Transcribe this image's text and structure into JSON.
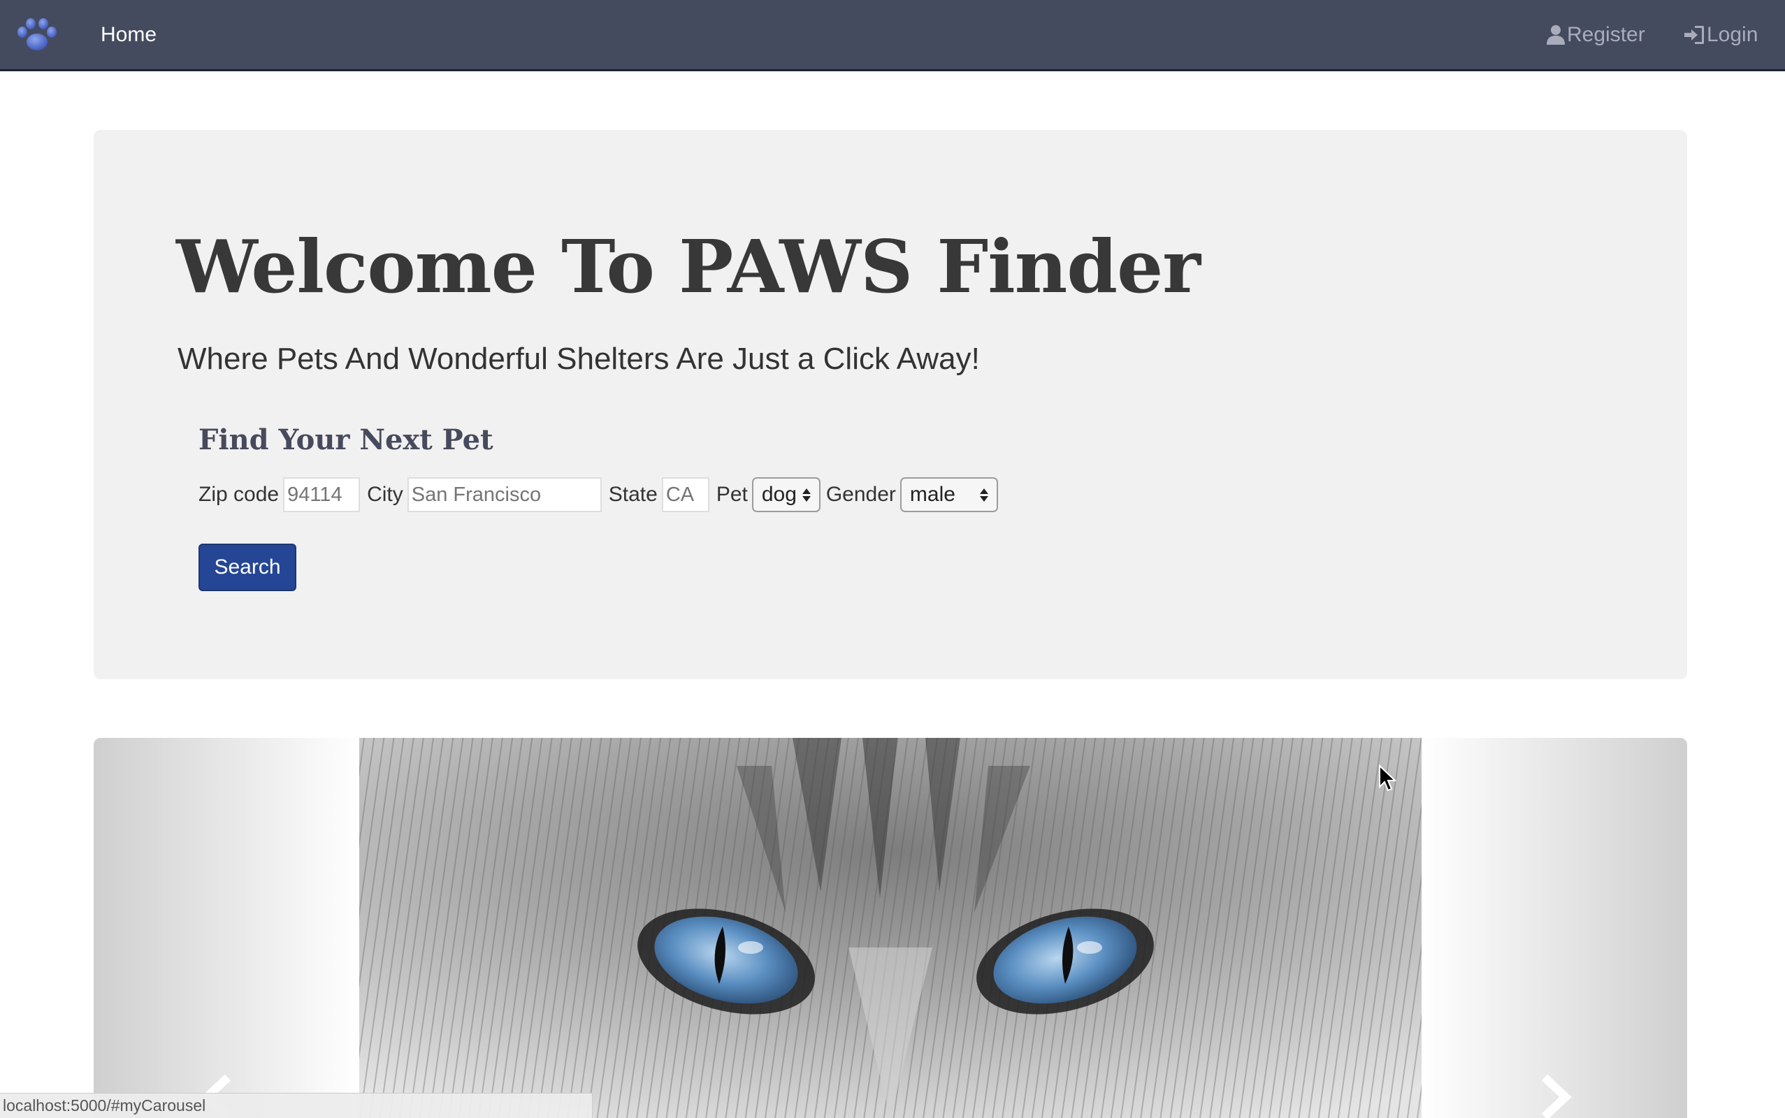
{
  "navbar": {
    "logo_icon": "paw-icon",
    "home_label": "Home",
    "register_label": "Register",
    "login_label": "Login"
  },
  "jumbotron": {
    "title": "Welcome To PAWS Finder",
    "subtitle": "Where Pets And Wonderful Shelters Are Just a Click Away!"
  },
  "search": {
    "heading": "Find Your Next Pet",
    "zip_label": "Zip code",
    "zip_placeholder": "94114",
    "city_label": "City",
    "city_placeholder": "San Francisco",
    "state_label": "State",
    "state_placeholder": "CA",
    "pet_label": "Pet",
    "pet_selected": "dog",
    "gender_label": "Gender",
    "gender_selected": "male",
    "button_label": "Search"
  },
  "carousel": {
    "image_subject": "blue-eyed gray tabby cat close-up"
  },
  "status_bar": {
    "url": "localhost:5000/#myCarousel"
  },
  "colors": {
    "navbar_bg": "#454b5e",
    "button_bg": "#254695",
    "jumbotron_bg": "#f1f1f1"
  }
}
